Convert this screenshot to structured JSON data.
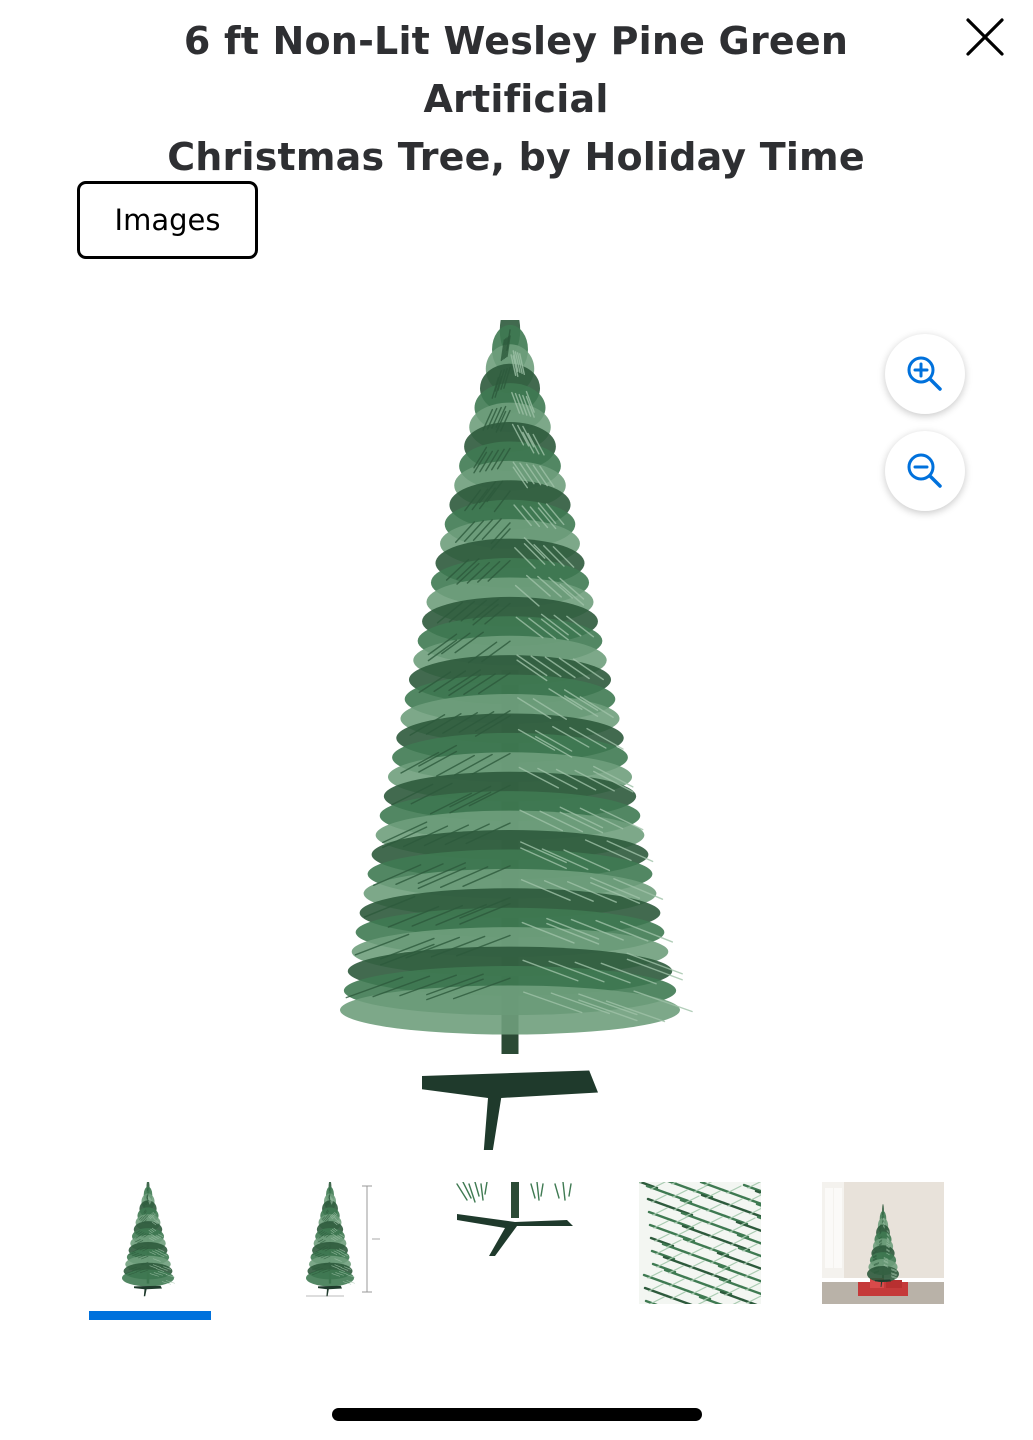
{
  "header": {
    "title_line1": "6 ft Non-Lit Wesley Pine Green Artificial",
    "title_line2": "Christmas Tree, by Holiday Time",
    "close_icon": "close-icon"
  },
  "tabs": {
    "images_label": "Images"
  },
  "viewer": {
    "zoom_in_icon": "zoom-in-icon",
    "zoom_out_icon": "zoom-out-icon",
    "selected_index": 0
  },
  "thumbnails": [
    {
      "name": "thumbnail-tree-front",
      "selected": true
    },
    {
      "name": "thumbnail-tree-dimensions",
      "selected": false
    },
    {
      "name": "thumbnail-tree-stand",
      "selected": false
    },
    {
      "name": "thumbnail-branch-closeup",
      "selected": false
    },
    {
      "name": "thumbnail-tree-in-room",
      "selected": false
    }
  ],
  "colors": {
    "accent": "#0071dc",
    "tree_dark": "#2d5a3c",
    "tree_mid": "#3f7a52",
    "tree_light": "#6f9f7c",
    "stand": "#1f3a2c"
  }
}
